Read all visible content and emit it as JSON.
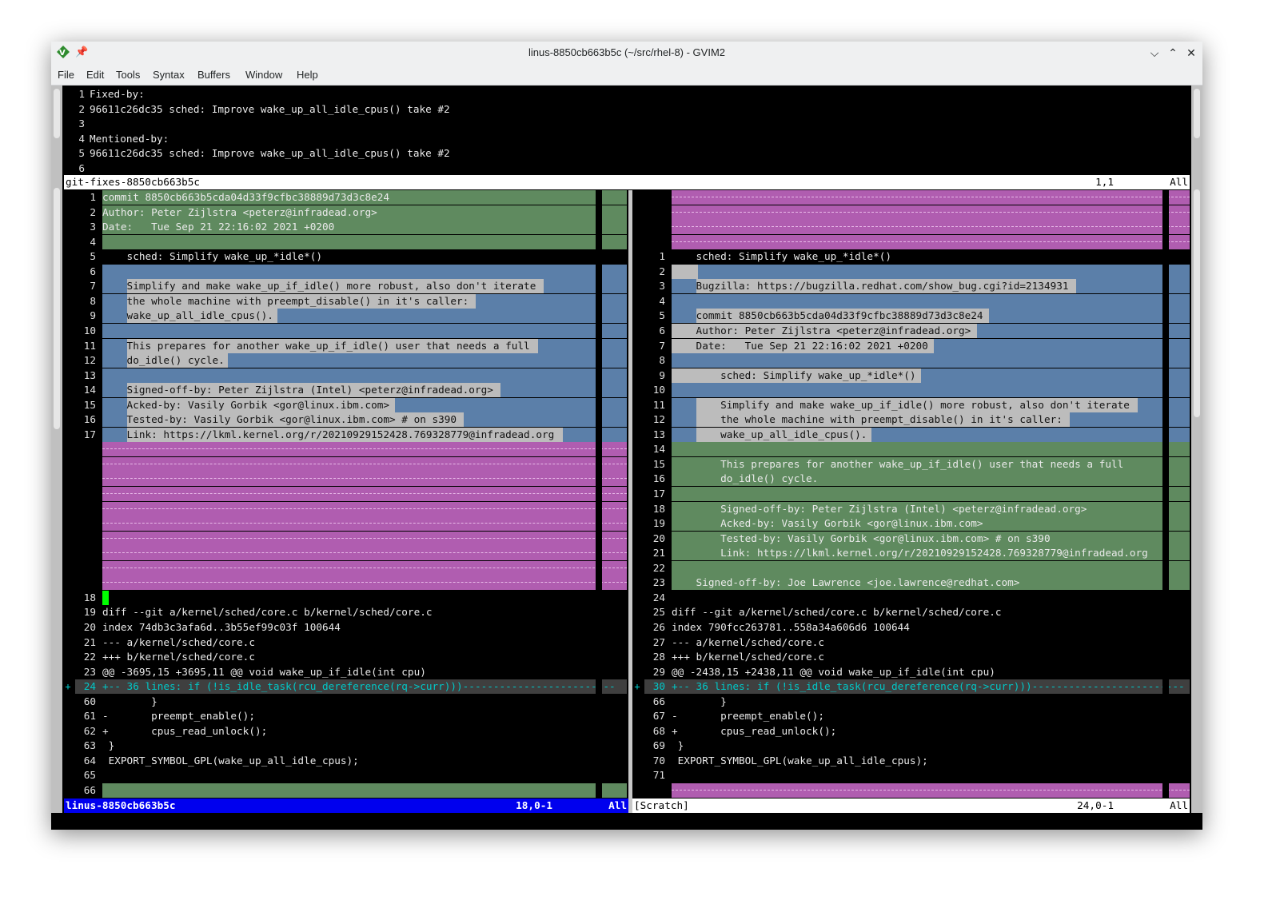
{
  "window": {
    "title": "linus-8850cb663b5c (~/src/rhel-8) - GVIM2"
  },
  "menubar": [
    "File",
    "Edit",
    "Tools",
    "Syntax",
    "Buffers",
    "Window",
    "Help"
  ],
  "colors": {
    "green": "#5f8a5f",
    "blue": "#5b7fa9",
    "magenta": "#b05db0",
    "textbg": "#bcbcbc",
    "fold": "#3f3f3f",
    "foldtext": "#00c8c8",
    "statusActive": "#0000ee",
    "statusInactive": "#ffffff"
  },
  "top": {
    "lines": [
      {
        "n": "1",
        "t": "Fixed-by:"
      },
      {
        "n": "2",
        "t": "96611c26dc35 sched: Improve wake_up_all_idle_cpus() take #2"
      },
      {
        "n": "3",
        "t": ""
      },
      {
        "n": "4",
        "t": "Mentioned-by:"
      },
      {
        "n": "5",
        "t": "96611c26dc35 sched: Improve wake_up_all_idle_cpus() take #2"
      },
      {
        "n": "6",
        "t": ""
      }
    ],
    "status": {
      "name": "git-fixes-8850cb663b5c",
      "pos": "1,1",
      "all": "All"
    }
  },
  "left": {
    "lines": [
      {
        "n": "1",
        "t": "commit 8850cb663b5cda04d33f9cfbc38889d73d3c8e24",
        "bg": "green"
      },
      {
        "n": "2",
        "t": "Author: Peter Zijlstra <peterz@infradead.org>",
        "bg": "green"
      },
      {
        "n": "3",
        "t": "Date:   Tue Sep 21 22:16:02 2021 +0200",
        "bg": "green"
      },
      {
        "n": "4",
        "t": "",
        "bg": "green"
      },
      {
        "n": "5",
        "t": "    sched: Simplify wake_up_*idle*()",
        "bg": ""
      },
      {
        "n": "6",
        "t": "",
        "bg": "blue"
      },
      {
        "n": "7",
        "t": "    Simplify and make wake_up_if_idle() more robust, also don't iterate",
        "bg": "blue",
        "hl": 4
      },
      {
        "n": "8",
        "t": "    the whole machine with preempt_disable() in it's caller:",
        "bg": "blue",
        "hl": 4
      },
      {
        "n": "9",
        "t": "    wake_up_all_idle_cpus().",
        "bg": "blue",
        "hl": 4
      },
      {
        "n": "10",
        "t": "",
        "bg": "blue"
      },
      {
        "n": "11",
        "t": "    This prepares for another wake_up_if_idle() user that needs a full",
        "bg": "blue",
        "hl": 4
      },
      {
        "n": "12",
        "t": "    do_idle() cycle.",
        "bg": "blue",
        "hl": 4
      },
      {
        "n": "13",
        "t": "",
        "bg": "blue"
      },
      {
        "n": "14",
        "t": "    Signed-off-by: Peter Zijlstra (Intel) <peterz@infradead.org>",
        "bg": "blue",
        "hl": 4
      },
      {
        "n": "15",
        "t": "    Acked-by: Vasily Gorbik <gor@linux.ibm.com>",
        "bg": "blue",
        "hl": 4
      },
      {
        "n": "16",
        "t": "    Tested-by: Vasily Gorbik <gor@linux.ibm.com> # on s390",
        "bg": "blue",
        "hl": 4
      },
      {
        "n": "17",
        "t": "    Link: https://lkml.kernel.org/r/20210929152428.769328779@infradead.org",
        "bg": "blue",
        "hl": 4
      },
      {
        "n": "",
        "t": "",
        "bg": "filler"
      },
      {
        "n": "",
        "t": "",
        "bg": "filler"
      },
      {
        "n": "",
        "t": "",
        "bg": "filler"
      },
      {
        "n": "",
        "t": "",
        "bg": "filler"
      },
      {
        "n": "",
        "t": "",
        "bg": "filler"
      },
      {
        "n": "",
        "t": "",
        "bg": "filler"
      },
      {
        "n": "",
        "t": "",
        "bg": "filler"
      },
      {
        "n": "",
        "t": "",
        "bg": "filler"
      },
      {
        "n": "",
        "t": "",
        "bg": "filler"
      },
      {
        "n": "",
        "t": "",
        "bg": "filler"
      },
      {
        "n": "18",
        "t": "",
        "bg": "",
        "cursor": true
      },
      {
        "n": "19",
        "t": "diff --git a/kernel/sched/core.c b/kernel/sched/core.c",
        "bg": ""
      },
      {
        "n": "20",
        "t": "index 74db3c3afa6d..3b55ef99c03f 100644",
        "bg": ""
      },
      {
        "n": "21",
        "t": "--- a/kernel/sched/core.c",
        "bg": ""
      },
      {
        "n": "22",
        "t": "+++ b/kernel/sched/core.c",
        "bg": ""
      },
      {
        "n": "23",
        "t": "@@ -3695,15 +3695,11 @@ void wake_up_if_idle(int cpu)",
        "bg": ""
      },
      {
        "n": "24",
        "t": "+-- 36 lines: if (!is_idle_task(rcu_dereference(rq->curr)))-------------------------",
        "bg": "fold",
        "sign": "+"
      },
      {
        "n": "60",
        "t": "        }",
        "bg": ""
      },
      {
        "n": "61",
        "t": "-       preempt_enable();",
        "bg": ""
      },
      {
        "n": "62",
        "t": "+       cpus_read_unlock();",
        "bg": ""
      },
      {
        "n": "63",
        "t": " }",
        "bg": ""
      },
      {
        "n": "64",
        "t": " EXPORT_SYMBOL_GPL(wake_up_all_idle_cpus);",
        "bg": ""
      },
      {
        "n": "65",
        "t": "",
        "bg": ""
      },
      {
        "n": "66",
        "t": "",
        "bg": "green"
      }
    ],
    "status": {
      "name": "linus-8850cb663b5c",
      "pos": "18,0-1",
      "all": "All"
    }
  },
  "right": {
    "lines": [
      {
        "n": "",
        "t": "",
        "bg": "filler"
      },
      {
        "n": "",
        "t": "",
        "bg": "filler"
      },
      {
        "n": "",
        "t": "",
        "bg": "filler"
      },
      {
        "n": "",
        "t": "",
        "bg": "filler"
      },
      {
        "n": "1",
        "t": "    sched: Simplify wake_up_*idle*()",
        "bg": ""
      },
      {
        "n": "2",
        "t": "",
        "bg": "blue",
        "hl": 0,
        "hlw": 4
      },
      {
        "n": "3",
        "t": "    Bugzilla: https://bugzilla.redhat.com/show_bug.cgi?id=2134931",
        "bg": "blue",
        "hl": 4
      },
      {
        "n": "4",
        "t": "",
        "bg": "blue"
      },
      {
        "n": "5",
        "t": "    commit 8850cb663b5cda04d33f9cfbc38889d73d3c8e24",
        "bg": "blue",
        "hl": 4
      },
      {
        "n": "6",
        "t": "    Author: Peter Zijlstra <peterz@infradead.org>",
        "bg": "blue",
        "hl": 0
      },
      {
        "n": "7",
        "t": "    Date:   Tue Sep 21 22:16:02 2021 +0200",
        "bg": "blue",
        "hl": 0
      },
      {
        "n": "8",
        "t": "",
        "bg": "blue"
      },
      {
        "n": "9",
        "t": "        sched: Simplify wake_up_*idle*()",
        "bg": "blue",
        "hl": 0
      },
      {
        "n": "10",
        "t": "",
        "bg": "blue"
      },
      {
        "n": "11",
        "t": "        Simplify and make wake_up_if_idle() more robust, also don't iterate",
        "bg": "blue",
        "hl": 4
      },
      {
        "n": "12",
        "t": "        the whole machine with preempt_disable() in it's caller:",
        "bg": "blue",
        "hl": 4
      },
      {
        "n": "13",
        "t": "        wake_up_all_idle_cpus().",
        "bg": "blue",
        "hl": 4
      },
      {
        "n": "14",
        "t": "",
        "bg": "green"
      },
      {
        "n": "15",
        "t": "        This prepares for another wake_up_if_idle() user that needs a full",
        "bg": "green"
      },
      {
        "n": "16",
        "t": "        do_idle() cycle.",
        "bg": "green"
      },
      {
        "n": "17",
        "t": "",
        "bg": "green"
      },
      {
        "n": "18",
        "t": "        Signed-off-by: Peter Zijlstra (Intel) <peterz@infradead.org>",
        "bg": "green"
      },
      {
        "n": "19",
        "t": "        Acked-by: Vasily Gorbik <gor@linux.ibm.com>",
        "bg": "green"
      },
      {
        "n": "20",
        "t": "        Tested-by: Vasily Gorbik <gor@linux.ibm.com> # on s390",
        "bg": "green"
      },
      {
        "n": "21",
        "t": "        Link: https://lkml.kernel.org/r/20210929152428.769328779@infradead.org",
        "bg": "green"
      },
      {
        "n": "22",
        "t": "",
        "bg": "green"
      },
      {
        "n": "23",
        "t": "    Signed-off-by: Joe Lawrence <joe.lawrence@redhat.com>",
        "bg": "green"
      },
      {
        "n": "24",
        "t": "",
        "bg": ""
      },
      {
        "n": "25",
        "t": "diff --git a/kernel/sched/core.c b/kernel/sched/core.c",
        "bg": ""
      },
      {
        "n": "26",
        "t": "index 790fcc263781..558a34a606d6 100644",
        "bg": ""
      },
      {
        "n": "27",
        "t": "--- a/kernel/sched/core.c",
        "bg": ""
      },
      {
        "n": "28",
        "t": "+++ b/kernel/sched/core.c",
        "bg": ""
      },
      {
        "n": "29",
        "t": "@@ -2438,15 +2438,11 @@ void wake_up_if_idle(int cpu)",
        "bg": ""
      },
      {
        "n": "30",
        "t": "+-- 36 lines: if (!is_idle_task(rcu_dereference(rq->curr)))-------------------------",
        "bg": "fold",
        "sign": "+"
      },
      {
        "n": "66",
        "t": "        }",
        "bg": ""
      },
      {
        "n": "67",
        "t": "-       preempt_enable();",
        "bg": ""
      },
      {
        "n": "68",
        "t": "+       cpus_read_unlock();",
        "bg": ""
      },
      {
        "n": "69",
        "t": " }",
        "bg": ""
      },
      {
        "n": "70",
        "t": " EXPORT_SYMBOL_GPL(wake_up_all_idle_cpus);",
        "bg": ""
      },
      {
        "n": "71",
        "t": "",
        "bg": ""
      },
      {
        "n": "",
        "t": "",
        "bg": "filler"
      }
    ],
    "status": {
      "name": "[Scratch]",
      "pos": "24,0-1",
      "all": "All"
    }
  }
}
